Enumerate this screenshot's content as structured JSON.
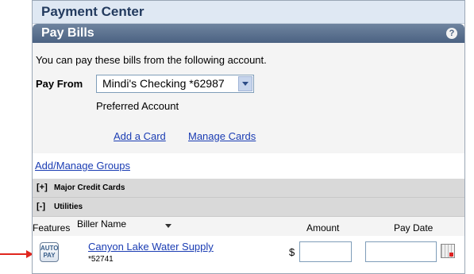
{
  "header": {
    "title": "Payment Center"
  },
  "panel": {
    "title": "Pay Bills",
    "help_icon": "?"
  },
  "account": {
    "intro": "You can pay these bills from the following account.",
    "pay_from_label": "Pay From",
    "selected_account": "Mindi's Checking *62987",
    "preferred_text": "Preferred Account"
  },
  "links": {
    "add_card": "Add a Card",
    "manage_cards": "Manage Cards",
    "add_manage_groups": "Add/Manage Groups"
  },
  "sections": [
    {
      "toggle": "[+]",
      "label": "Major Credit Cards"
    },
    {
      "toggle": "[-]",
      "label": "Utilities"
    }
  ],
  "columns": {
    "features": "Features",
    "biller_name": "Biller Name",
    "amount": "Amount",
    "pay_date": "Pay Date"
  },
  "bills": [
    {
      "autopay_top": "AUTO",
      "autopay_bottom": "PAY",
      "biller": "Canyon Lake Water Supply",
      "account": "*52741",
      "currency": "$",
      "amount": "",
      "pay_date": ""
    }
  ],
  "icons": {
    "help": "help-icon",
    "calendar": "calendar-icon",
    "autopay": "autopay-icon",
    "dropdown": "chevron-down-icon",
    "sort": "sort-desc-icon",
    "pointer": "red-arrow-icon"
  },
  "colors": {
    "header_bg": "#dfe8f3",
    "bar_bg": "#5a7090",
    "link": "#1a3cb3",
    "pointer_arrow": "#e0261e"
  }
}
